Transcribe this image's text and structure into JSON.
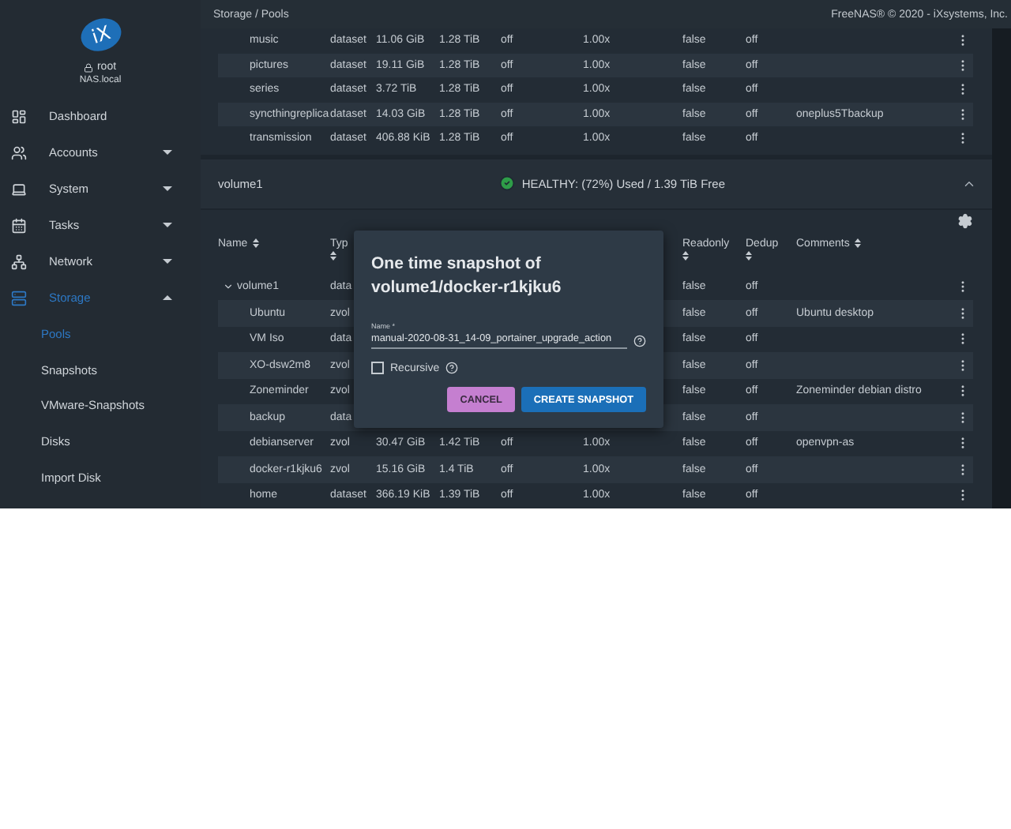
{
  "header": {
    "breadcrumb": "Storage / Pools",
    "copyright": "FreeNAS® © 2020 - iXsystems, Inc."
  },
  "sidebar": {
    "logo": "iX",
    "user": "root",
    "host": "NAS.local",
    "items": [
      {
        "label": "Dashboard",
        "kind": "link",
        "selected": false
      },
      {
        "label": "Accounts",
        "kind": "group",
        "expanded": false,
        "selected": false
      },
      {
        "label": "System",
        "kind": "group",
        "expanded": false,
        "selected": false
      },
      {
        "label": "Tasks",
        "kind": "group",
        "expanded": false,
        "selected": false
      },
      {
        "label": "Network",
        "kind": "group",
        "expanded": false,
        "selected": false
      },
      {
        "label": "Storage",
        "kind": "group",
        "expanded": true,
        "selected": true,
        "children": [
          {
            "label": "Pools",
            "selected": true
          },
          {
            "label": "Snapshots",
            "selected": false
          },
          {
            "label": "VMware-Snapshots",
            "selected": false
          },
          {
            "label": "Disks",
            "selected": false
          },
          {
            "label": "Import Disk",
            "selected": false
          }
        ]
      }
    ]
  },
  "pool_rows": [
    {
      "name": "music",
      "type": "dataset",
      "used": "11.06 GiB",
      "available": "1.28 TiB",
      "compression": "off",
      "ratio": "1.00x",
      "readonly": "false",
      "dedup": "off"
    },
    {
      "name": "pictures",
      "type": "dataset",
      "used": "19.11 GiB",
      "available": "1.28 TiB",
      "compression": "off",
      "ratio": "1.00x",
      "readonly": "false",
      "dedup": "off"
    },
    {
      "name": "series",
      "type": "dataset",
      "used": "3.72 TiB",
      "available": "1.28 TiB",
      "compression": "off",
      "ratio": "1.00x",
      "readonly": "false",
      "dedup": "off"
    },
    {
      "name": "syncthingreplica",
      "type": "dataset",
      "used": "14.03 GiB",
      "available": "1.28 TiB",
      "compression": "off",
      "ratio": "1.00x",
      "readonly": "false",
      "dedup": "off",
      "comments": "oneplus5Tbackup"
    },
    {
      "name": "transmission",
      "type": "dataset",
      "used": "406.88 KiB",
      "available": "1.28 TiB",
      "compression": "off",
      "ratio": "1.00x",
      "readonly": "false",
      "dedup": "off"
    }
  ],
  "volume": {
    "name": "volume1",
    "status": "HEALTHY: (72%) Used / 1.39 TiB Free",
    "healthy": true,
    "expanded": true,
    "columns": [
      {
        "label": "Name"
      },
      {
        "label": "Typ"
      },
      {
        "label": "Readonly"
      },
      {
        "label": "Dedup"
      },
      {
        "label": "Comments"
      }
    ],
    "rows": [
      {
        "name": "volume1",
        "type": "data",
        "readonly": "false",
        "dedup": "off",
        "expanded": true,
        "children": [
          {
            "name": "Ubuntu",
            "type": "zvol",
            "readonly": "false",
            "dedup": "off",
            "comments": "Ubuntu desktop"
          },
          {
            "name": "VM Iso",
            "type": "data",
            "readonly": "false",
            "dedup": "off"
          },
          {
            "name": "XO-dsw2m8",
            "type": "zvol",
            "readonly": "false",
            "dedup": "off"
          },
          {
            "name": "Zoneminder",
            "type": "zvol",
            "readonly": "false",
            "dedup": "off",
            "comments": "Zoneminder debian distro"
          },
          {
            "name": "backup",
            "type": "data",
            "readonly": "false",
            "dedup": "off"
          },
          {
            "name": "debianserver",
            "type": "zvol",
            "used": "30.47 GiB",
            "available": "1.42 TiB",
            "compression": "off",
            "ratio": "1.00x",
            "readonly": "false",
            "dedup": "off",
            "comments": "openvpn-as"
          },
          {
            "name": "docker-r1kjku6",
            "type": "zvol",
            "used": "15.16 GiB",
            "available": "1.4 TiB",
            "compression": "off",
            "ratio": "1.00x",
            "readonly": "false",
            "dedup": "off"
          },
          {
            "name": "home",
            "type": "dataset",
            "used": "366.19 KiB",
            "available": "1.39 TiB",
            "compression": "off",
            "ratio": "1.00x",
            "readonly": "false",
            "dedup": "off"
          }
        ]
      }
    ]
  },
  "dialog": {
    "title": "One time snapshot of volume1/docker-r1kjku6",
    "field_label": "Name *",
    "field_value": "manual-2020-08-31_14-09_portainer_upgrade_action",
    "recursive_label": "Recursive",
    "recursive_checked": false,
    "buttons": [
      {
        "label": "CANCEL",
        "kind": "secondary"
      },
      {
        "label": "CREATE SNAPSHOT",
        "kind": "primary"
      }
    ]
  }
}
